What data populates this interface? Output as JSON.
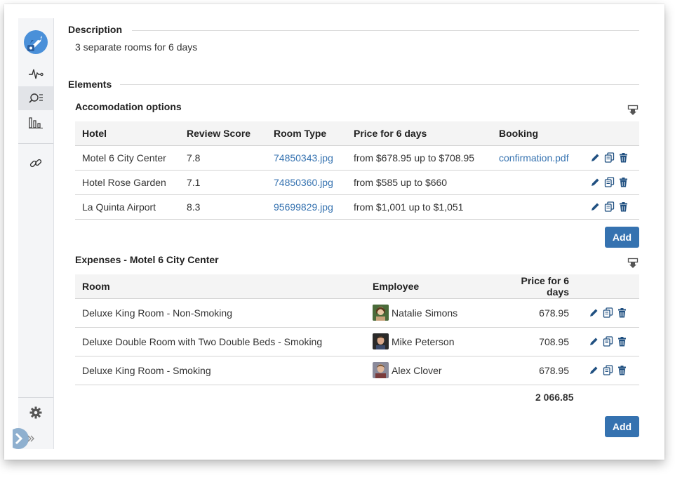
{
  "description": {
    "title": "Description",
    "text": "3 separate rooms for 6 days"
  },
  "elements": {
    "title": "Elements"
  },
  "accommodation": {
    "title": "Accomodation options",
    "headers": [
      "Hotel",
      "Review Score",
      "Room Type",
      "Price for 6 days",
      "Booking"
    ],
    "rows": [
      {
        "hotel": "Motel 6 City Center",
        "score": "7.8",
        "room": "74850343.jpg",
        "price": "from $678.95 up to $708.95",
        "booking": "confirmation.pdf"
      },
      {
        "hotel": "Hotel Rose Garden",
        "score": "7.1",
        "room": "74850360.jpg",
        "price": "from $585 up to $660",
        "booking": ""
      },
      {
        "hotel": "La Quinta Airport",
        "score": "8.3",
        "room": "95699829.jpg",
        "price": "from $1,001 up to $1,051",
        "booking": ""
      }
    ],
    "add_label": "Add"
  },
  "expenses": {
    "title": "Expenses - Motel 6 City Center",
    "headers": [
      "Room",
      "Employee",
      "Price for 6 days"
    ],
    "rows": [
      {
        "room": "Deluxe King Room - Non-Smoking",
        "employee": "Natalie Simons",
        "price": "678.95"
      },
      {
        "room": "Deluxe Double Room with Two Double Beds - Smoking",
        "employee": "Mike Peterson",
        "price": "708.95"
      },
      {
        "room": "Deluxe King Room - Smoking",
        "employee": "Alex Clover",
        "price": "678.95"
      }
    ],
    "total": "2 066.85",
    "add_label": "Add"
  },
  "sidebar": {
    "icons": [
      "rocket-logo-icon",
      "activity-icon",
      "search-list-icon",
      "bar-chart-icon",
      "link-icon",
      "gear-icon",
      "expand-icon"
    ]
  },
  "colors": {
    "accent": "#3572b0",
    "icon": "#205081"
  }
}
